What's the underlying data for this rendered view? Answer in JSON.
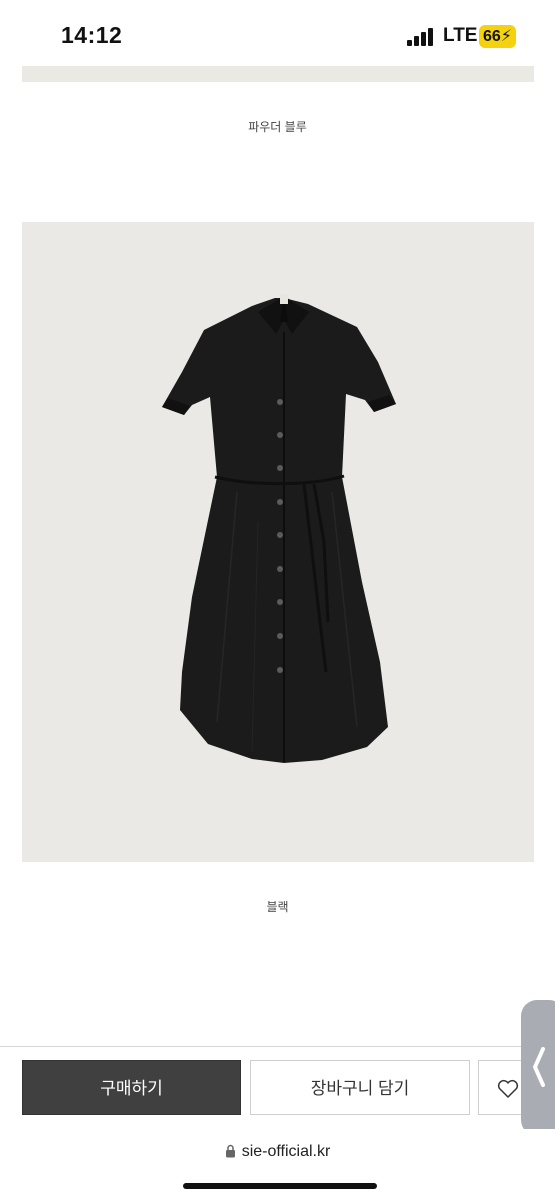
{
  "status_bar": {
    "time": "14:12",
    "network": "LTE",
    "battery": "66",
    "battery_color": "#f5d20e"
  },
  "product": {
    "color_option_1": "파우더 블루",
    "color_option_2": "블랙",
    "photo_background": "#ebe9e6",
    "dress_color": "#1b1b1b"
  },
  "actions": {
    "buy_label": "구매하기",
    "cart_label": "장바구니 담기",
    "wishlist_icon": "heart-icon",
    "buy_button_color": "#404040"
  },
  "browser": {
    "url": "sie-official.kr",
    "lock_icon": "lock-icon",
    "back_icon": "chevron-left-icon"
  }
}
